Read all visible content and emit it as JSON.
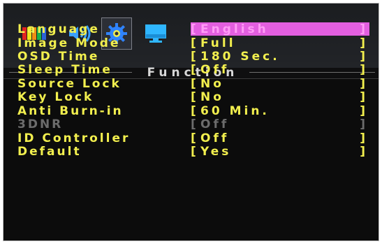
{
  "tabs": [
    {
      "icon": "color-bars-icon",
      "selected": false
    },
    {
      "icon": "audio-speaker-icon",
      "selected": false
    },
    {
      "icon": "gear-icon",
      "selected": true
    },
    {
      "icon": "monitor-icon",
      "selected": false
    }
  ],
  "section_title": "Function",
  "menu": [
    {
      "label": "Language",
      "value": "English",
      "highlight": true,
      "disabled": false
    },
    {
      "label": "Image Mode",
      "value": "Full",
      "highlight": false,
      "disabled": false
    },
    {
      "label": "OSD Time",
      "value": "180 Sec.",
      "highlight": false,
      "disabled": false
    },
    {
      "label": "Sleep Time",
      "value": "Off",
      "highlight": false,
      "disabled": false
    },
    {
      "label": "Source Lock",
      "value": "No",
      "highlight": false,
      "disabled": false
    },
    {
      "label": "Key Lock",
      "value": "No",
      "highlight": false,
      "disabled": false
    },
    {
      "label": "Anti Burn-in",
      "value": "60 Min.",
      "highlight": false,
      "disabled": false
    },
    {
      "label": "3DNR",
      "value": "Off",
      "highlight": false,
      "disabled": true
    },
    {
      "label": "ID Controller",
      "value": "Off",
      "highlight": false,
      "disabled": false
    },
    {
      "label": "Default",
      "value": "Yes",
      "highlight": false,
      "disabled": false
    }
  ],
  "colors": {
    "text": "#f2ef4e",
    "disabled": "#6c6c6c",
    "highlight_bg": "#e35fe0",
    "highlight_text": "#ff9cf6"
  }
}
